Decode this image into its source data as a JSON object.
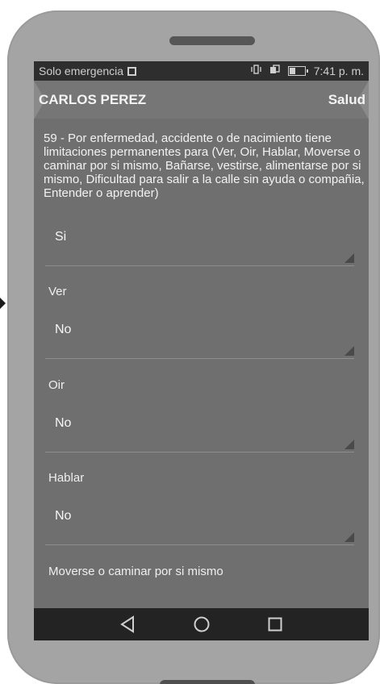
{
  "status_bar": {
    "carrier": "Solo emergencia",
    "time": "7:41 p. m.",
    "icons": [
      "sim-icon",
      "vibrate-icon",
      "screen-rotate-icon",
      "battery-icon"
    ]
  },
  "app_bar": {
    "title": "CARLOS PEREZ",
    "action": "Salud"
  },
  "question": {
    "text": "59 - Por enfermedad, accidente o de nacimiento tiene limitaciones permanentes para (Ver, Oir, Hablar, Moverse o caminar por si mismo, Bañarse, vestirse, alimentarse por si mismo, Dificultad para salir a la calle sin ayuda o compañia, Entender o aprender)"
  },
  "fields": [
    {
      "label": "",
      "value": "Si"
    },
    {
      "label": "Ver",
      "value": "No"
    },
    {
      "label": "Oir",
      "value": "No"
    },
    {
      "label": "Hablar",
      "value": "No"
    },
    {
      "label": "Moverse o caminar por si mismo",
      "value": ""
    }
  ],
  "nav": {
    "icons": [
      "back-icon",
      "home-icon",
      "recents-icon"
    ]
  },
  "colors": {
    "phone_body": "#a4a4a4",
    "screen_bg": "#6f6f6f",
    "status_bar_bg": "#2e2e2e",
    "nav_bar_bg": "#232323",
    "text": "#f2f2f2"
  }
}
